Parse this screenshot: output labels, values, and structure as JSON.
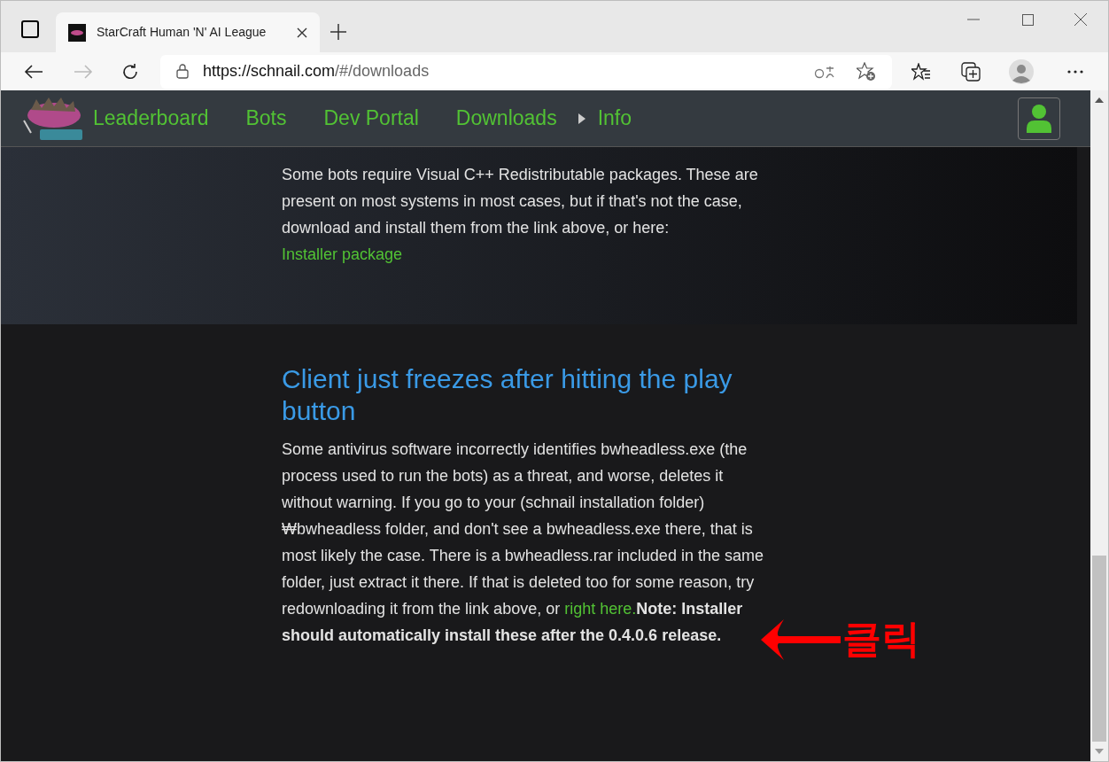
{
  "browser": {
    "tab_title": "StarCraft Human 'N' AI League",
    "url_host": "https://schnail.com",
    "url_path": "/#/downloads"
  },
  "nav": {
    "items": [
      {
        "label": "Leaderboard",
        "kind": "link"
      },
      {
        "label": "Bots",
        "kind": "link"
      },
      {
        "label": "Dev Portal",
        "kind": "link"
      },
      {
        "label": "Downloads",
        "kind": "link"
      },
      {
        "label": "Info",
        "kind": "caret-link"
      }
    ]
  },
  "sections": [
    {
      "text": "Some bots require Visual C++ Redistributable packages. These are present on most systems in most cases, but if that's not the case, download and install them from the link above, or here: ",
      "link": "Installer package"
    },
    {
      "title": "Client just freezes after hitting the play button",
      "text": "Some antivirus software incorrectly identifies bwheadless.exe (the process used to run the bots) as a threat, and worse, deletes it without warning. If you go to your (schnail installation folder)₩bwheadless folder, and don't see a bwheadless.exe there, that is most likely the case. There is a bwheadless.rar included in the same folder, just extract it there. If that is deleted too for some reason, try redownloading it from the link above, or ",
      "link": "right here.",
      "note": "Note: Installer should automatically install these after the 0.4.0.6 release."
    }
  ],
  "annotation": {
    "label": "클릭"
  }
}
